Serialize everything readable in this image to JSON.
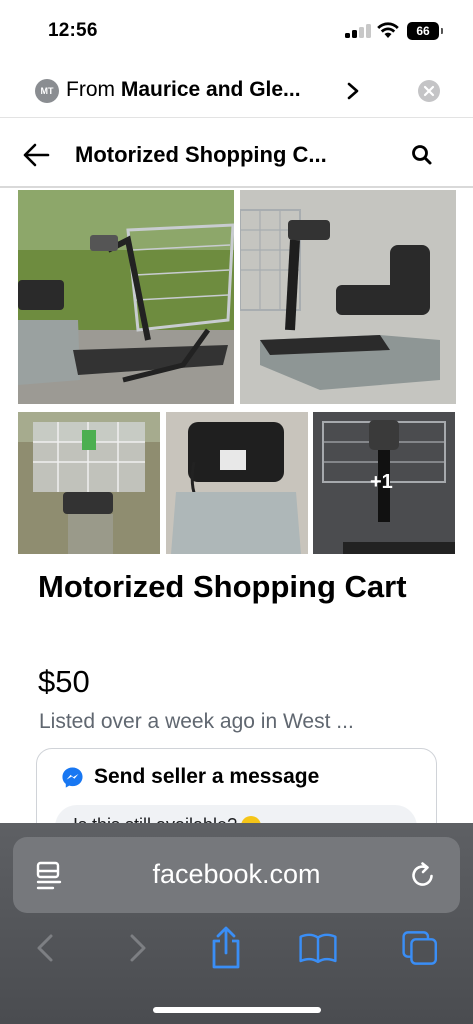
{
  "status_bar": {
    "time": "12:56",
    "battery": "66"
  },
  "from_banner": {
    "avatar_initials": "MT",
    "prefix": "From",
    "name": "Maurice and Gle..."
  },
  "header": {
    "title": "Motorized Shopping C..."
  },
  "photos": {
    "more_count": "+1"
  },
  "listing": {
    "title": "Motorized Shopping Cart",
    "price": "$50",
    "meta": "Listed over a week ago in West ..."
  },
  "message_card": {
    "heading": "Send seller a message",
    "input_value": "Is this still available?"
  },
  "browser": {
    "url": "facebook.com"
  },
  "colors": {
    "accent": "#1877f2",
    "toolbar_icon": "#3a8ef6",
    "disabled_icon": "#7d7f83"
  },
  "icons": [
    "signal-icon",
    "wifi-icon",
    "battery-icon",
    "chevron-right-icon",
    "close-icon",
    "back-arrow-icon",
    "search-icon",
    "messenger-icon",
    "reader-icon",
    "reload-icon",
    "share-icon",
    "bookmarks-icon",
    "tabs-icon"
  ]
}
